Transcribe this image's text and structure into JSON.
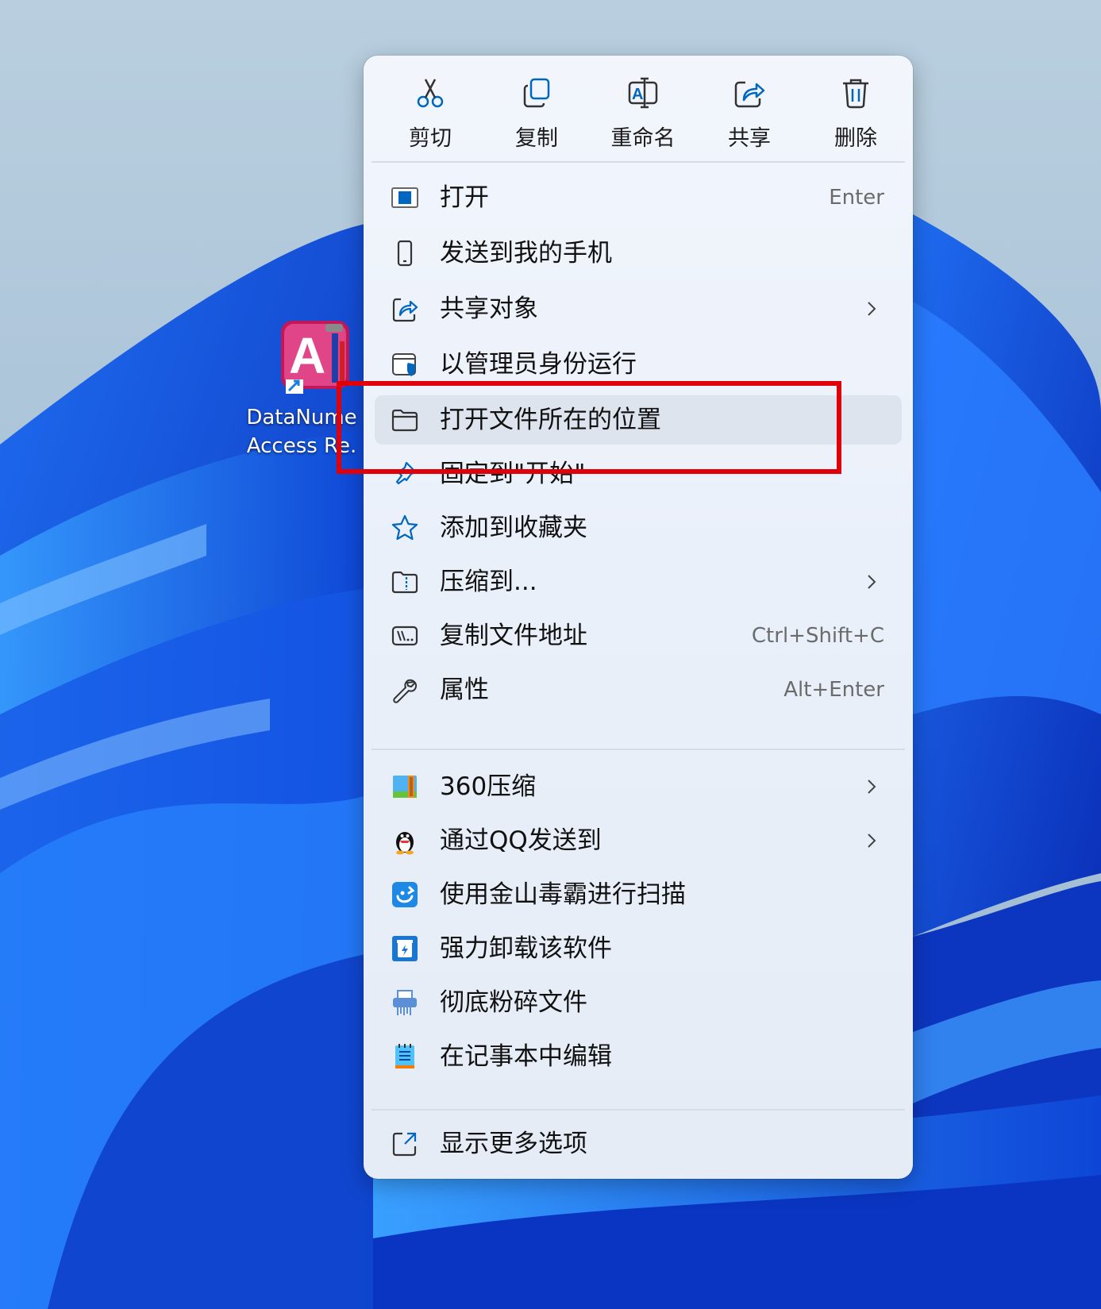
{
  "desktop": {
    "shortcut_label": "DataNume\nAccess Re."
  },
  "toolbar": {
    "cut": "剪切",
    "copy": "复制",
    "rename": "重命名",
    "share": "共享",
    "delete": "删除"
  },
  "menu": {
    "items": [
      {
        "label": "打开",
        "shortcut": "Enter"
      },
      {
        "label": "发送到我的手机"
      },
      {
        "label": "共享对象"
      },
      {
        "label": "以管理员身份运行"
      },
      {
        "label": "打开文件所在的位置"
      },
      {
        "label": "固定到\"开始\""
      },
      {
        "label": "添加到收藏夹"
      },
      {
        "label": "压缩到..."
      },
      {
        "label": "复制文件地址",
        "shortcut": "Ctrl+Shift+C"
      },
      {
        "label": "属性",
        "shortcut": "Alt+Enter"
      }
    ],
    "third_party": [
      {
        "label": "360压缩"
      },
      {
        "label": "通过QQ发送到"
      },
      {
        "label": "使用金山毒霸进行扫描"
      },
      {
        "label": "强力卸载该软件"
      },
      {
        "label": "彻底粉碎文件"
      },
      {
        "label": "在记事本中编辑"
      }
    ],
    "more": {
      "label": "显示更多选项"
    }
  },
  "colors": {
    "accent": "#0067c0",
    "highlight": "#dde4ee",
    "annotation": "#e0000a"
  }
}
